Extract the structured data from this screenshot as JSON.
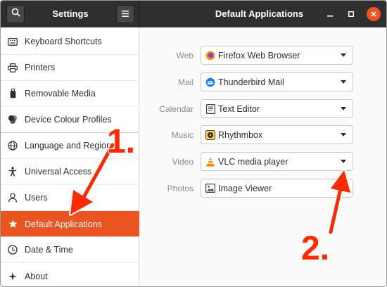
{
  "header": {
    "sidebar_title": "Settings",
    "panel_title": "Default Applications",
    "search_icon": "search-icon",
    "menu_icon": "hamburger-menu-icon"
  },
  "window_controls": [
    "minimize-icon",
    "maximize-icon",
    "close-icon"
  ],
  "sidebar": {
    "items": [
      {
        "label": "Keyboard Shortcuts",
        "icon": "keyboard-icon",
        "active": false
      },
      {
        "label": "Printers",
        "icon": "printer-icon",
        "active": false
      },
      {
        "label": "Removable Media",
        "icon": "usb-drive-icon",
        "active": false
      },
      {
        "label": "Device Colour Profiles",
        "icon": "color-profile-icon",
        "active": false
      },
      {
        "label": "Language and Region",
        "icon": "globe-icon",
        "active": false
      },
      {
        "label": "Universal Access",
        "icon": "accessibility-icon",
        "active": false
      },
      {
        "label": "Users",
        "icon": "user-icon",
        "active": false
      },
      {
        "label": "Default Applications",
        "icon": "star-icon",
        "active": true
      },
      {
        "label": "Date & Time",
        "icon": "clock-icon",
        "active": false
      },
      {
        "label": "About",
        "icon": "about-icon",
        "active": false
      }
    ]
  },
  "defaults": [
    {
      "label": "Web",
      "value": "Firefox Web Browser",
      "icon": "firefox-icon"
    },
    {
      "label": "Mail",
      "value": "Thunderbird Mail",
      "icon": "thunderbird-icon"
    },
    {
      "label": "Calendar",
      "value": "Text Editor",
      "icon": "text-editor-icon"
    },
    {
      "label": "Music",
      "value": "Rhythmbox",
      "icon": "rhythmbox-icon"
    },
    {
      "label": "Video",
      "value": "VLC media player",
      "icon": "vlc-icon"
    },
    {
      "label": "Photos",
      "value": "Image Viewer",
      "icon": "image-viewer-icon"
    }
  ],
  "annotations": {
    "step1": "1.",
    "step2": "2.",
    "color": "#ff2a00"
  },
  "colors": {
    "accent": "#e95420",
    "headerbar": "#2f2f2f"
  }
}
